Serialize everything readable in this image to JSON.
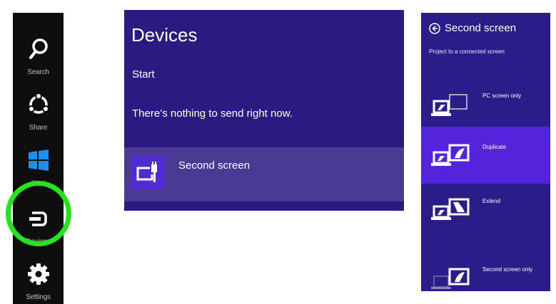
{
  "charms": [
    {
      "label": "Search",
      "icon": "search-icon"
    },
    {
      "label": "Share",
      "icon": "share-icon"
    },
    {
      "label": "Start",
      "icon": "windows-logo-icon"
    },
    {
      "label": "Devices",
      "icon": "devices-icon"
    },
    {
      "label": "Settings",
      "icon": "gear-icon"
    }
  ],
  "highlight_color": "#22e619",
  "devices_panel": {
    "title": "Devices",
    "start_label": "Start",
    "message": "There’s nothing to send right now.",
    "item": {
      "name": "Second screen",
      "icon": "second-screen-plug-icon"
    }
  },
  "second_screen_panel": {
    "title": "Second screen",
    "subtitle": "Project to a connected screen",
    "options": [
      {
        "label": "PC screen only",
        "selected": false
      },
      {
        "label": "Duplicate",
        "selected": true
      },
      {
        "label": "Extend",
        "selected": false
      },
      {
        "label": "Second screen only",
        "selected": false
      }
    ]
  },
  "colors": {
    "panel_bg": "#2b1a7f",
    "item_bg": "#4b3a94",
    "selected_bg": "#5324dc",
    "charms_bg": "#0e0e0e"
  }
}
